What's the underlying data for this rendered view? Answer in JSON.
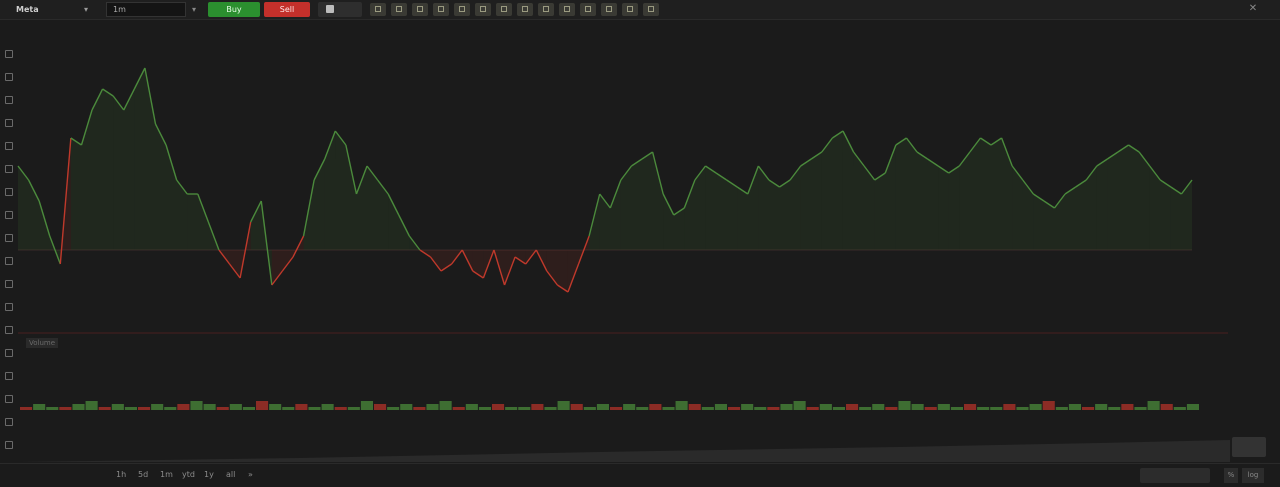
{
  "topbar": {
    "symbol": "Meta",
    "symbol_input": "1m",
    "buy_label": "Buy",
    "sell_label": "Sell",
    "tools": [
      "chart-type-icon",
      "indicator-icon",
      "drawing-icon",
      "template-icon",
      "compare-icon",
      "alert-icon",
      "replay-icon",
      "settings-icon",
      "camera-icon",
      "layout-icon",
      "fullscreen-icon",
      "undo-icon",
      "redo-icon",
      "more-icon"
    ]
  },
  "left_toolbar": [
    "crosshair-icon",
    "trendline-icon",
    "fib-icon",
    "brush-icon",
    "text-icon",
    "pattern-icon",
    "forecast-icon",
    "measure-icon",
    "zoom-icon",
    "magnet-icon",
    "lock-icon",
    "eye-icon",
    "trash-icon",
    "star-icon",
    "ruler-icon",
    "cursor-icon",
    "anchor-icon",
    "layers-icon"
  ],
  "legend": "",
  "volume": {
    "label": "Volume",
    "value": ""
  },
  "bottombar": {
    "date_range": "",
    "timeframes": [
      "1h",
      "5d",
      "1m",
      "ytd",
      "1y",
      "all",
      "»"
    ],
    "range_dropdown": "",
    "pct": "%",
    "log": "log"
  },
  "colors": {
    "up": "#4b8a3c",
    "down": "#c0392b",
    "bg": "#1b1b1b"
  },
  "chart_data": {
    "type": "area",
    "title": "",
    "baseline_level": 0.5,
    "y_tick_count": 19,
    "x_ticks": [
      "",
      "",
      "",
      "",
      "",
      "",
      "",
      "",
      "",
      "",
      "",
      "",
      "",
      "",
      "",
      "",
      "",
      "",
      "",
      "",
      "",
      ""
    ],
    "price_series": [
      0.62,
      0.6,
      0.57,
      0.52,
      0.48,
      0.66,
      0.65,
      0.7,
      0.73,
      0.72,
      0.7,
      0.73,
      0.76,
      0.68,
      0.65,
      0.6,
      0.58,
      0.58,
      0.54,
      0.5,
      0.48,
      0.46,
      0.54,
      0.57,
      0.45,
      0.47,
      0.49,
      0.52,
      0.6,
      0.63,
      0.67,
      0.65,
      0.58,
      0.62,
      0.6,
      0.58,
      0.55,
      0.52,
      0.5,
      0.49,
      0.47,
      0.48,
      0.5,
      0.47,
      0.46,
      0.5,
      0.45,
      0.49,
      0.48,
      0.5,
      0.47,
      0.45,
      0.44,
      0.48,
      0.52,
      0.58,
      0.56,
      0.6,
      0.62,
      0.63,
      0.64,
      0.58,
      0.55,
      0.56,
      0.6,
      0.62,
      0.61,
      0.6,
      0.59,
      0.58,
      0.62,
      0.6,
      0.59,
      0.6,
      0.62,
      0.63,
      0.64,
      0.66,
      0.67,
      0.64,
      0.62,
      0.6,
      0.61,
      0.65,
      0.66,
      0.64,
      0.63,
      0.62,
      0.61,
      0.62,
      0.64,
      0.66,
      0.65,
      0.66,
      0.62,
      0.6,
      0.58,
      0.57,
      0.56,
      0.58,
      0.59,
      0.6,
      0.62,
      0.63,
      0.64,
      0.65,
      0.64,
      0.62,
      0.6,
      0.59,
      0.58,
      0.6
    ],
    "volume_series": [
      1,
      2,
      1,
      1,
      2,
      3,
      1,
      2,
      1,
      1,
      2,
      1,
      2,
      3,
      2,
      1,
      2,
      1,
      3,
      2,
      1,
      2,
      1,
      2,
      1,
      1,
      3,
      2,
      1,
      2,
      1,
      2,
      3,
      1,
      2,
      1,
      2,
      1,
      1,
      2,
      1,
      3,
      2,
      1,
      2,
      1,
      2,
      1,
      2,
      1,
      3,
      2,
      1,
      2,
      1,
      2,
      1,
      1,
      2,
      3,
      1,
      2,
      1,
      2,
      1,
      2,
      1,
      3,
      2,
      1,
      2,
      1,
      2,
      1,
      1,
      2,
      1,
      2,
      3,
      1,
      2,
      1,
      2,
      1,
      2,
      1,
      3,
      2,
      1,
      2
    ]
  }
}
